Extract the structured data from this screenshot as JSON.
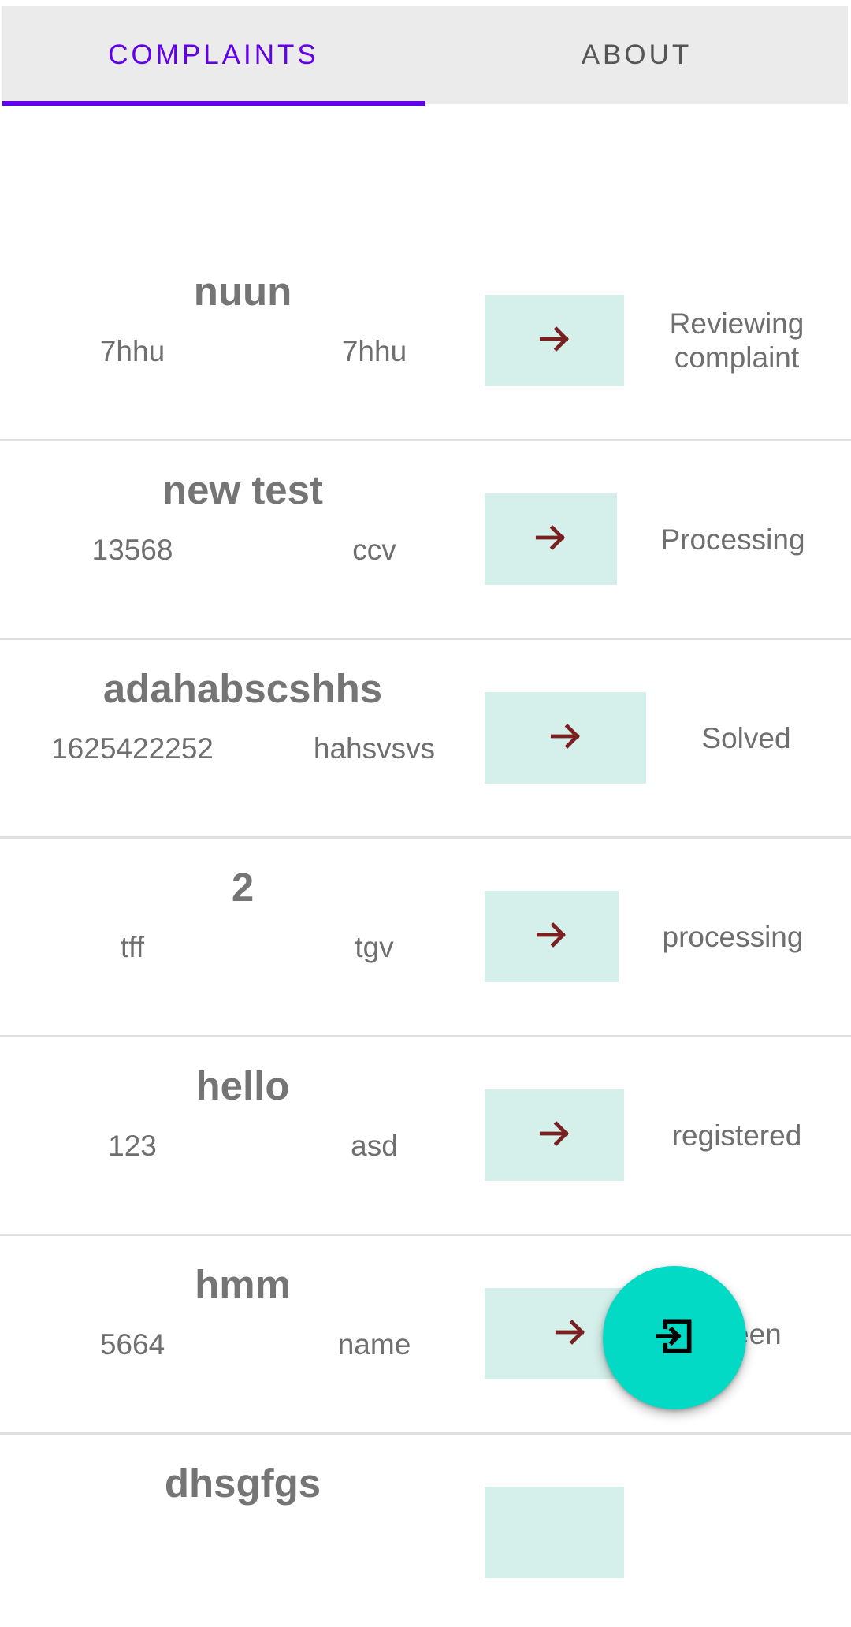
{
  "tabs": [
    {
      "label": "COMPLAINTS",
      "active": true
    },
    {
      "label": "ABOUT",
      "active": false
    }
  ],
  "complaints": [
    {
      "title": "nuun",
      "left": "7hhu",
      "right": "7hhu",
      "status": "Reviewing complaint"
    },
    {
      "title": "new test",
      "left": "13568",
      "right": "ccv",
      "status": "Processing"
    },
    {
      "title": "adahabscshhs",
      "left": "1625422252",
      "right": "hahsvsvs",
      "status": "Solved"
    },
    {
      "title": "2",
      "left": "tff",
      "right": "tgv",
      "status": "processing"
    },
    {
      "title": "hello",
      "left": "123",
      "right": "asd",
      "status": "registered"
    },
    {
      "title": "hmm",
      "left": "5664",
      "right": "name",
      "status": "een"
    },
    {
      "title": "dhsgfgs",
      "left": "",
      "right": "",
      "status": ""
    }
  ],
  "icons": {
    "row_action": "arrow-right-icon",
    "fab": "exit-to-app-icon"
  },
  "colors": {
    "accent": "#6200ee",
    "fab": "#03dac5",
    "arrow_button_bg": "#d5efea",
    "arrow": "#7b2020"
  }
}
